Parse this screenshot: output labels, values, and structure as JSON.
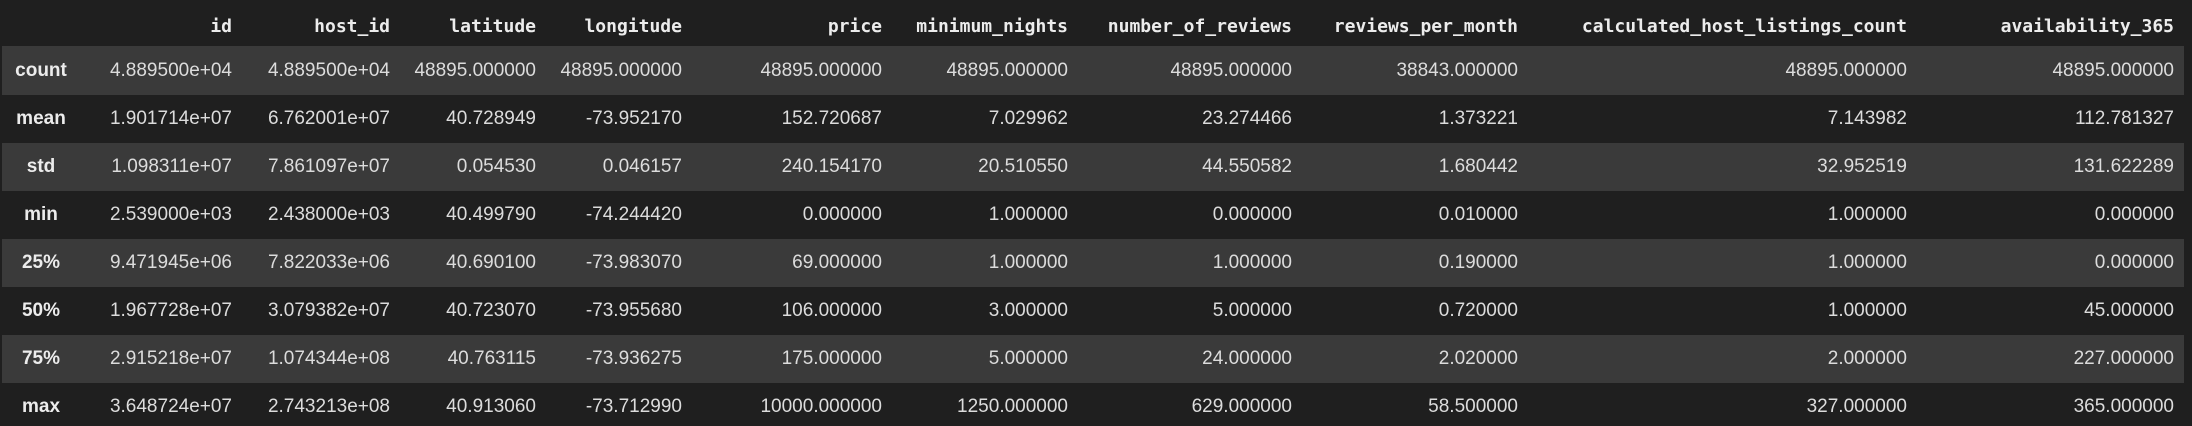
{
  "table": {
    "columns": [
      "",
      "id",
      "host_id",
      "latitude",
      "longitude",
      "price",
      "minimum_nights",
      "number_of_reviews",
      "reviews_per_month",
      "calculated_host_listings_count",
      "availability_365"
    ],
    "rows": [
      {
        "label": "count",
        "cells": [
          "4.889500e+04",
          "4.889500e+04",
          "48895.000000",
          "48895.000000",
          "48895.000000",
          "48895.000000",
          "48895.000000",
          "38843.000000",
          "48895.000000",
          "48895.000000"
        ]
      },
      {
        "label": "mean",
        "cells": [
          "1.901714e+07",
          "6.762001e+07",
          "40.728949",
          "-73.952170",
          "152.720687",
          "7.029962",
          "23.274466",
          "1.373221",
          "7.143982",
          "112.781327"
        ]
      },
      {
        "label": "std",
        "cells": [
          "1.098311e+07",
          "7.861097e+07",
          "0.054530",
          "0.046157",
          "240.154170",
          "20.510550",
          "44.550582",
          "1.680442",
          "32.952519",
          "131.622289"
        ]
      },
      {
        "label": "min",
        "cells": [
          "2.539000e+03",
          "2.438000e+03",
          "40.499790",
          "-74.244420",
          "0.000000",
          "1.000000",
          "0.000000",
          "0.010000",
          "1.000000",
          "0.000000"
        ]
      },
      {
        "label": "25%",
        "cells": [
          "9.471945e+06",
          "7.822033e+06",
          "40.690100",
          "-73.983070",
          "69.000000",
          "1.000000",
          "1.000000",
          "0.190000",
          "1.000000",
          "0.000000"
        ]
      },
      {
        "label": "50%",
        "cells": [
          "1.967728e+07",
          "3.079382e+07",
          "40.723070",
          "-73.955680",
          "106.000000",
          "3.000000",
          "5.000000",
          "0.720000",
          "1.000000",
          "45.000000"
        ]
      },
      {
        "label": "75%",
        "cells": [
          "2.915218e+07",
          "1.074344e+08",
          "40.763115",
          "-73.936275",
          "175.000000",
          "5.000000",
          "24.000000",
          "2.020000",
          "2.000000",
          "227.000000"
        ]
      },
      {
        "label": "max",
        "cells": [
          "3.648724e+07",
          "2.743213e+08",
          "40.913060",
          "-73.712990",
          "10000.000000",
          "1250.000000",
          "629.000000",
          "58.500000",
          "327.000000",
          "365.000000"
        ]
      }
    ]
  }
}
